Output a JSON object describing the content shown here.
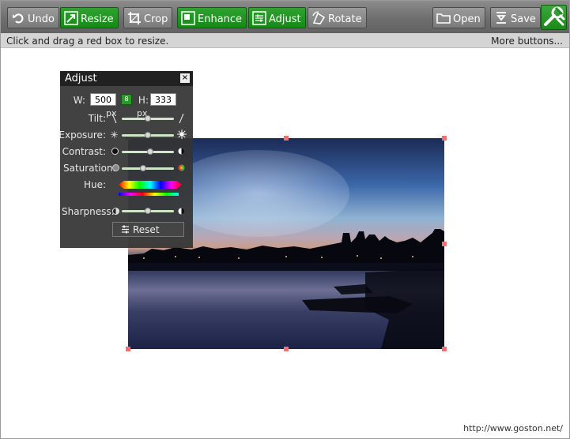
{
  "toolbar": {
    "buttons": [
      {
        "label": "Undo",
        "icon": "undo-icon"
      },
      {
        "label": "Resize",
        "icon": "resize-icon"
      },
      {
        "label": "Crop",
        "icon": "crop-icon"
      },
      {
        "label": "Enhance",
        "icon": "enhance-icon"
      },
      {
        "label": "Adjust",
        "icon": "adjust-icon"
      },
      {
        "label": "Rotate",
        "icon": "rotate-icon"
      },
      {
        "label": "Open",
        "icon": "folder-icon"
      },
      {
        "label": "Save",
        "icon": "save-icon"
      }
    ],
    "wrench_icon": "wrench-icon",
    "accent_color": "#1e8f1e"
  },
  "status": {
    "hint": "Click and drag a red box to resize.",
    "more": "More buttons..."
  },
  "adjust": {
    "title": "Adjust",
    "close": "×",
    "width_label": "W:",
    "width_value": "500",
    "height_label": "H:",
    "height_value": "333",
    "unit": "px",
    "tilt_label": "Tilt:",
    "exposure_label": "Exposure:",
    "contrast_label": "Contrast:",
    "saturation_label": "Saturation:",
    "hue_label": "Hue:",
    "sharpness_label": "Sharpness:",
    "reset_label": "Reset",
    "sliders": {
      "tilt": 0.5,
      "exposure": 0.5,
      "contrast": 0.55,
      "saturation": 0.4,
      "sharpness": 0.5
    }
  },
  "watermark": "http://www.goston.net/"
}
